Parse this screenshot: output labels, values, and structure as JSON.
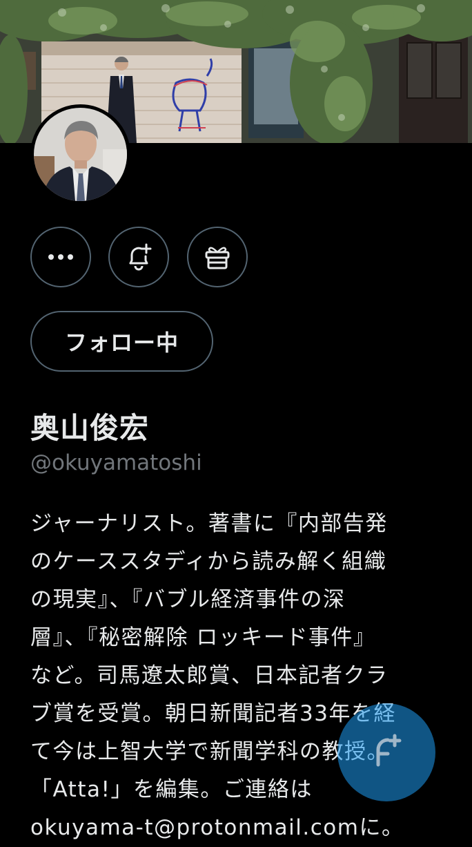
{
  "profile": {
    "display_name": "奥山俊宏",
    "handle": "@okuyamatoshi",
    "follow_button_label": "フォロー中",
    "bio_lines": [
      "ジャーナリスト。著書に『内部告発",
      "のケーススタディから読み解く組織",
      "の現実』、『バブル経済事件の深",
      "層』、『秘密解除 ロッキード事件』",
      "など。司馬遼太郎賞、日本記者クラ",
      "ブ賞を受賞。朝日新聞記者33年を経",
      "て今は上智大学で新聞学科の教授。",
      "「Atta!」を編集。ご連絡は",
      "okuyama-t@protonmail.comに。"
    ]
  },
  "actions": {
    "more_icon": "more-horizontal-icon",
    "notify_icon": "bell-plus-icon",
    "gift_icon": "gift-icon",
    "compose_icon": "compose-plus-icon"
  },
  "colors": {
    "background": "#000000",
    "text_primary": "#e7e9ea",
    "text_secondary": "#71767b",
    "border": "#536471",
    "accent": "#1d9bf0"
  }
}
